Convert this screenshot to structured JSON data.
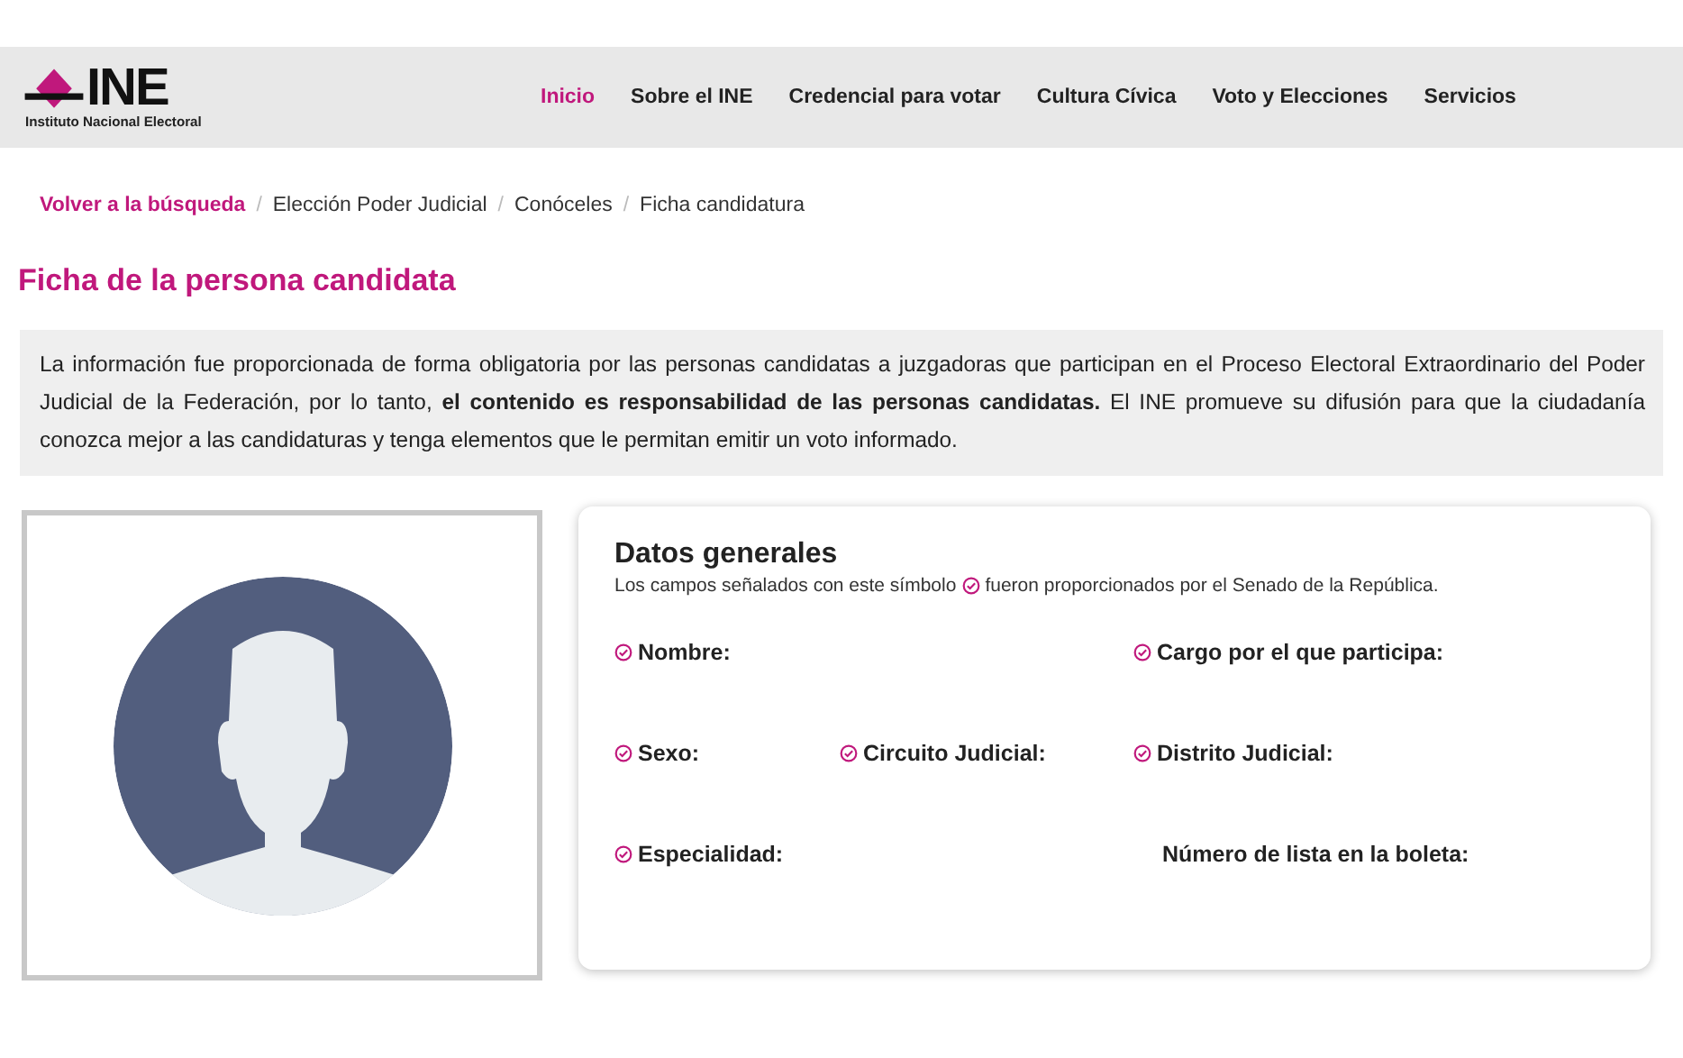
{
  "logo": {
    "name": "INE",
    "subtitle": "Instituto Nacional Electoral"
  },
  "nav": [
    {
      "label": "Inicio",
      "selected": true
    },
    {
      "label": "Sobre el INE",
      "selected": false
    },
    {
      "label": "Credencial para votar",
      "selected": false
    },
    {
      "label": "Cultura Cívica",
      "selected": false
    },
    {
      "label": "Voto y Elecciones",
      "selected": false
    },
    {
      "label": "Servicios",
      "selected": false
    }
  ],
  "breadcrumb_separator": "/",
  "breadcrumb": [
    {
      "label": "Volver a la búsqueda",
      "link": true
    },
    {
      "label": "Elección Poder Judicial",
      "link": false
    },
    {
      "label": "Conóceles",
      "link": false
    },
    {
      "label": "Ficha candidatura",
      "link": false
    }
  ],
  "title": "Ficha de la persona candidata",
  "notice": "La información fue proporcionada de forma obligatoria por las personas candidatas a juzgadoras que participan en el Proceso Electoral Extraordinario del Poder Judicial de la Federación, por lo tanto, **el contenido es responsabilidad de las personas candidatas.** El INE promueve su difusión para que la ciudadanía conozca mejor a las candidaturas y tenga elementos que le permitan emitir un voto informado.",
  "card": {
    "title": "Datos generales",
    "legend_before": "Los campos señalados con este símbolo",
    "legend_after": "fueron proporcionados por el Senado de la República.",
    "fields": [
      {
        "label": "Nombre:",
        "verified": true,
        "wide": true
      },
      {
        "label": "Cargo por el que participa:",
        "verified": true
      },
      {
        "label": "Sexo:",
        "verified": true
      },
      {
        "label": "Circuito Judicial:",
        "verified": true
      },
      {
        "label": "Distrito Judicial:",
        "verified": true
      },
      {
        "label": "Especialidad:",
        "verified": true,
        "wide": true
      },
      {
        "label": "Número de lista en la boleta:",
        "verified": false
      }
    ]
  }
}
